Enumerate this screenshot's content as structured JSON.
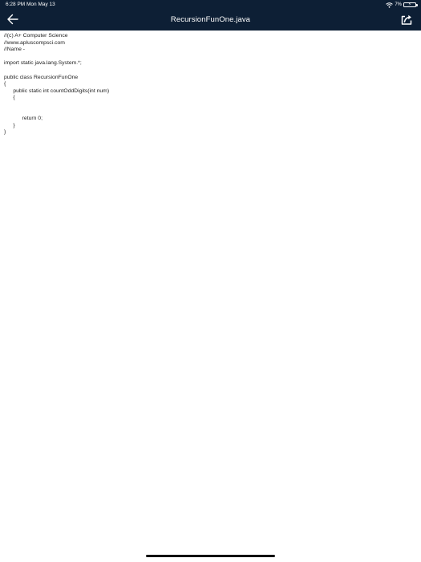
{
  "status_bar": {
    "time_date": "6:28 PM   Mon May 13",
    "battery_percent": "7%",
    "wifi_icon": "wifi-icon",
    "battery_icon": "battery-charging-icon"
  },
  "header": {
    "title": "RecursionFunOne.java",
    "back_icon": "arrow-left-icon",
    "share_icon": "share-icon",
    "background_color": "#0d1f35"
  },
  "code": {
    "lines": [
      "//(c) A+ Computer Science",
      "//www.apluscompsci.com",
      "//Name -",
      "",
      "import static java.lang.System.*;",
      "",
      "public class RecursionFunOne",
      "{",
      "      public static int countOddDigits(int num)",
      "      {",
      "",
      "",
      "            return 0;",
      "      }",
      "}"
    ]
  }
}
